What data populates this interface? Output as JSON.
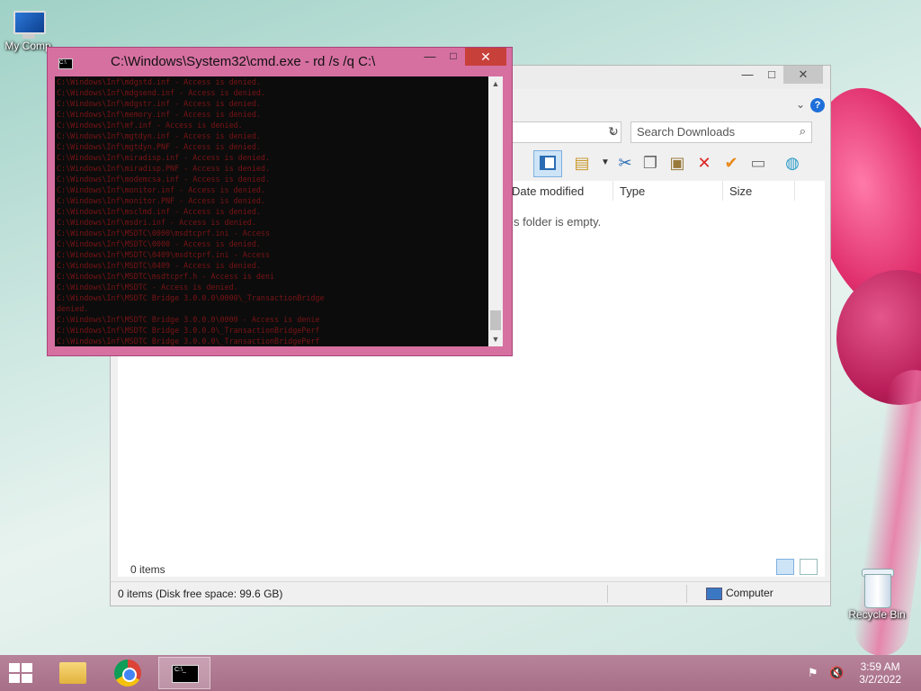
{
  "desktop": {
    "icons": [
      {
        "label": "My Comp"
      },
      {
        "label": "Recycle Bin"
      }
    ]
  },
  "explorer": {
    "window_buttons": {
      "minimize": "—",
      "maximize": "□",
      "close": "✕"
    },
    "search_placeholder": "Search Downloads",
    "columns": [
      "Date modified",
      "Type",
      "Size"
    ],
    "empty_message": "s folder is empty.",
    "item_count": "0 items",
    "status_left": "0 items (Disk free space: 99.6 GB)",
    "status_right": "Computer"
  },
  "cmd": {
    "title": "C:\\Windows\\System32\\cmd.exe - rd  /s /q C:\\",
    "window_buttons": {
      "minimize": "—",
      "maximize": "□",
      "close": "✕"
    },
    "lines": [
      "C:\\Windows\\Inf\\mdgstd.inf - Access is denied.",
      "C:\\Windows\\Inf\\mdgsend.inf - Access is denied.",
      "C:\\Windows\\Inf\\mdgstr.inf - Access is denied.",
      "C:\\Windows\\Inf\\memory.inf - Access is denied.",
      "C:\\Windows\\Inf\\mf.inf - Access is denied.",
      "C:\\Windows\\Inf\\mgtdyn.inf - Access is denied.",
      "C:\\Windows\\Inf\\mgtdyn.PNF - Access is denied.",
      "C:\\Windows\\Inf\\miradisp.inf - Access is denied.",
      "C:\\Windows\\Inf\\miradisp.PNF - Access is denied.",
      "C:\\Windows\\Inf\\modemcsa.inf - Access is denied.",
      "C:\\Windows\\Inf\\monitor.inf - Access is denied.",
      "C:\\Windows\\Inf\\monitor.PNF - Access is denied.",
      "C:\\Windows\\Inf\\msclmd.inf - Access is denied.",
      "C:\\Windows\\Inf\\msdri.inf - Access is denied.",
      "C:\\Windows\\Inf\\MSDTC\\0000\\msdtcprf.ini - Access",
      "C:\\Windows\\Inf\\MSDTC\\0000 - Access is denied.",
      "C:\\Windows\\Inf\\MSDTC\\0409\\msdtcprf.ini - Access",
      "C:\\Windows\\Inf\\MSDTC\\0409 - Access is denied.",
      "C:\\Windows\\Inf\\MSDTC\\msdtcprf.h - Access is deni",
      "C:\\Windows\\Inf\\MSDTC - Access is denied.",
      "C:\\Windows\\Inf\\MSDTC Bridge 3.0.0.0\\0000\\_TransactionBridge",
      "denied.",
      "C:\\Windows\\Inf\\MSDTC Bridge 3.0.0.0\\0000 - Access is denie",
      "C:\\Windows\\Inf\\MSDTC Bridge 3.0.0.0\\_TransactionBridgePerf",
      "C:\\Windows\\Inf\\MSDTC Bridge 3.0.0.0\\_TransactionBridgePerf"
    ]
  },
  "taskbar": {
    "items": [
      "file-explorer",
      "chrome",
      "command-prompt"
    ],
    "clock_time": "3:59 AM",
    "clock_date": "3/2/2022"
  },
  "colors": {
    "console_text": "#7a1416",
    "cmd_frame": "#d670a1",
    "taskbar": "#a76f88"
  }
}
